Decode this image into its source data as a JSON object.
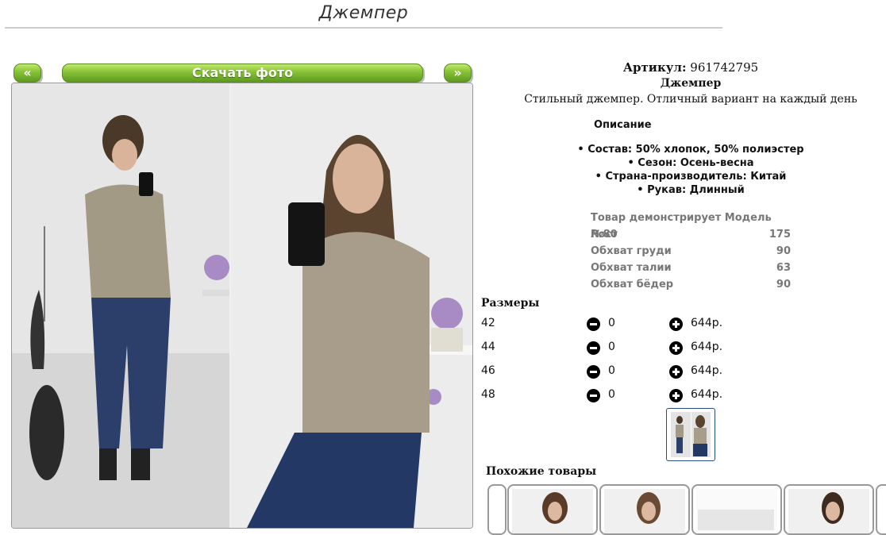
{
  "page": {
    "title": "Джемпер"
  },
  "gallery": {
    "prev_label": "«",
    "download_label": "Скачать фото",
    "next_label": "»"
  },
  "product": {
    "sku_label": "Артикул:",
    "sku_value": "961742795",
    "name": "Джемпер",
    "short_description": "Стильный джемпер. Отличный вариант на каждый день"
  },
  "description": {
    "heading": "Описание",
    "properties": [
      "• Состав: 50% хлопок, 50% полиэстер",
      "• Сезон: Осень-весна",
      "• Страна-производитель: Китай",
      "• Рукав: Длинный"
    ]
  },
  "model": {
    "heading": "Товар демонстрирует Модель №80",
    "rows": [
      {
        "label": "Рост",
        "value": "175"
      },
      {
        "label": "Обхват груди",
        "value": "90"
      },
      {
        "label": "Обхват талии",
        "value": "63"
      },
      {
        "label": "Обхват бёдер",
        "value": "90"
      }
    ]
  },
  "sizes": {
    "heading": "Размеры",
    "rows": [
      {
        "size": "42",
        "qty": "0",
        "price": "644р."
      },
      {
        "size": "44",
        "qty": "0",
        "price": "644р."
      },
      {
        "size": "46",
        "qty": "0",
        "price": "644р."
      },
      {
        "size": "48",
        "qty": "0",
        "price": "644р."
      }
    ]
  },
  "similar": {
    "heading": "Похожие товары"
  },
  "colors": {
    "button_green": "#8ac43a",
    "thumb_border": "#2a4f7a",
    "model_text": "#777777"
  },
  "icons": {
    "minus": "minus-circle-icon",
    "plus": "plus-circle-icon"
  }
}
